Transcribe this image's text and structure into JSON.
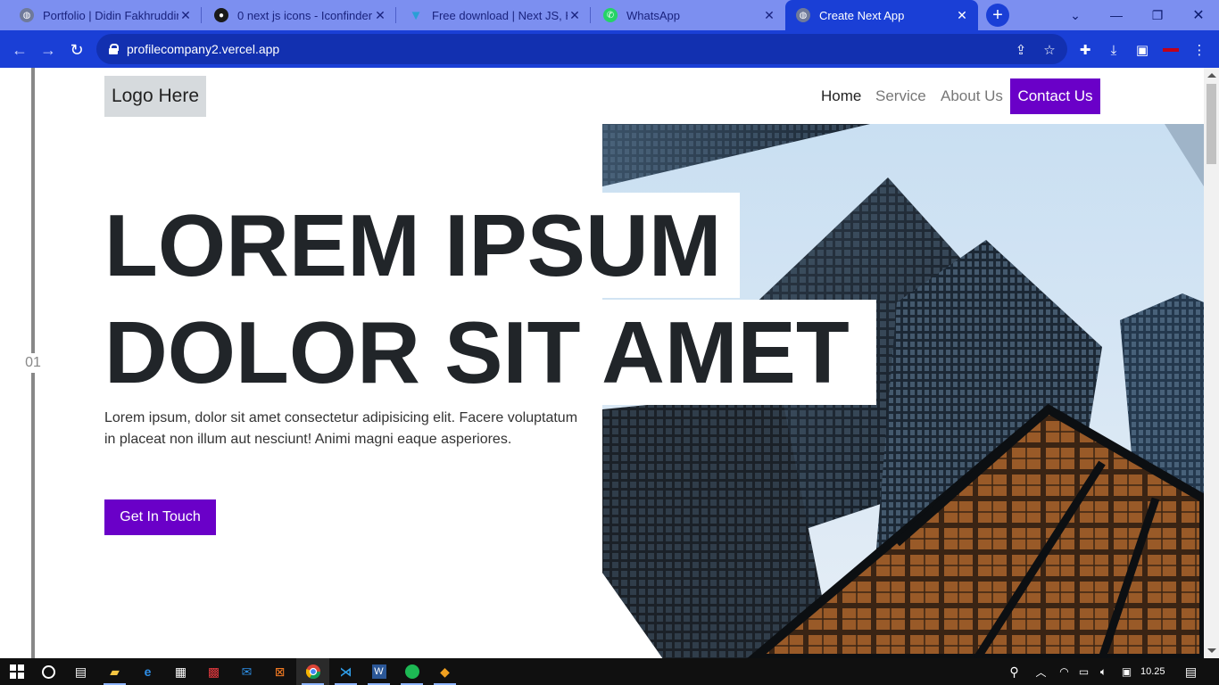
{
  "browser": {
    "tabs": [
      {
        "title": "Portfolio | Didin Fakhruddin",
        "icon": "globe-icon",
        "active": false
      },
      {
        "title": "0 next js icons - Iconfinder",
        "icon": "iconfinder-icon",
        "active": false
      },
      {
        "title": "Free download | Next JS, HD.",
        "icon": "vuesax-icon",
        "active": false
      },
      {
        "title": "WhatsApp",
        "icon": "whatsapp-icon",
        "active": false
      },
      {
        "title": "Create Next App",
        "icon": "globe-icon",
        "active": true
      }
    ],
    "url": "profilecompany2.vercel.app"
  },
  "page": {
    "logo": "Logo Here",
    "nav": {
      "home": "Home",
      "service": "Service",
      "about": "About Us",
      "contact": "Contact Us"
    },
    "section_number": "01",
    "headline_line1": "LOREM IPSUM",
    "headline_line2": "DOLOR SIT AMET",
    "lead": "Lorem ipsum, dolor sit amet consectetur adipisicing elit. Facere voluptatum in placeat non illum aut nesciunt! Animi magni eaque asperiores.",
    "cta": "Get In Touch",
    "accent_color": "#6a00c8"
  },
  "taskbar": {
    "time": "10.25",
    "apps": [
      "windows-start-icon",
      "cortana-icon",
      "task-view-icon",
      "file-explorer-icon",
      "edge-icon",
      "store-icon",
      "gift-icon",
      "mail-icon",
      "xampp-icon",
      "chrome-icon",
      "vscode-icon",
      "word-icon",
      "spotify-icon",
      "git-icon"
    ]
  }
}
